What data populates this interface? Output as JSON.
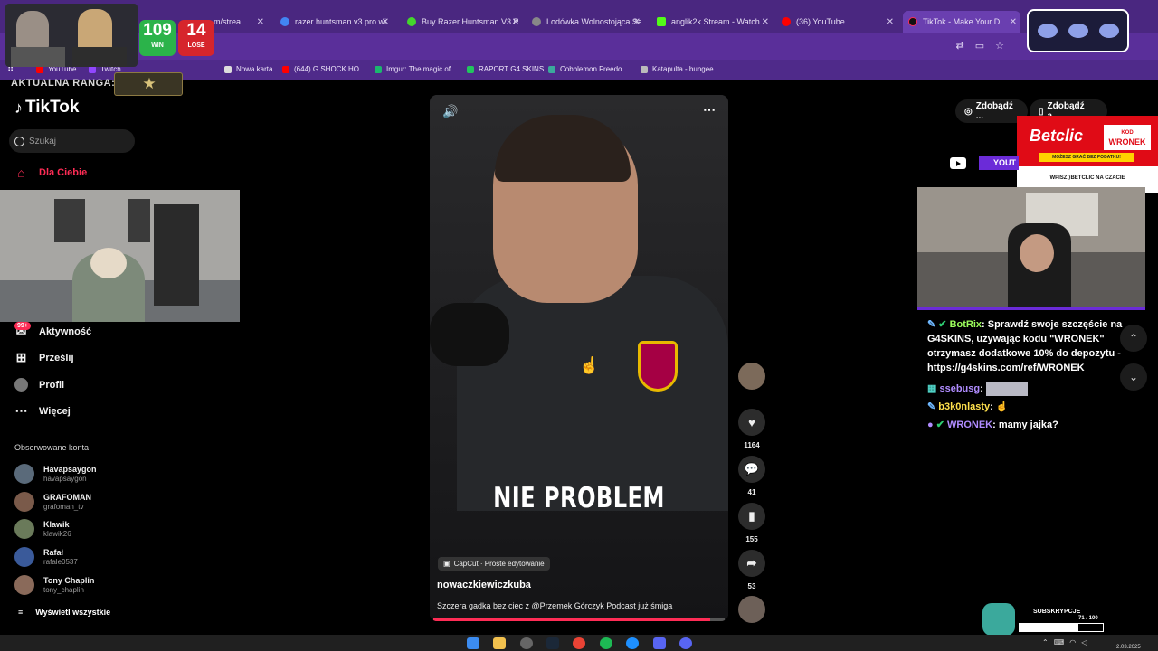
{
  "browser": {
    "tabs": [
      {
        "label": "m/strea",
        "color": "#8a8a8a"
      },
      {
        "label": "razer huntsman v3 pro wi",
        "color": "#4285f4"
      },
      {
        "label": "Buy Razer Huntsman V3 P",
        "color": "#44d62c"
      },
      {
        "label": "Lodówka Wolnostojąca Sa",
        "color": "#888888"
      },
      {
        "label": "anglik2k Stream - Watch",
        "color": "#53fc18"
      },
      {
        "label": "(36) YouTube",
        "color": "#ff0000"
      },
      {
        "label": "TikTok - Make Your D",
        "color": "#111111"
      }
    ],
    "bookmarks": [
      {
        "label": "YouTube",
        "color": "#ff0000"
      },
      {
        "label": "Twitch",
        "color": "#9146ff"
      },
      {
        "label": "Nowa karta",
        "color": "#dddddd"
      },
      {
        "label": "(644) G SHOCK HO...",
        "color": "#ff0000"
      },
      {
        "label": "Imgur: The magic of...",
        "color": "#1bb76e"
      },
      {
        "label": "RAPORT G4 SKINS",
        "color": "#22c55e"
      },
      {
        "label": "Cobblemon Freedo...",
        "color": "#3ba99c"
      },
      {
        "label": "Katapulta - bungee...",
        "color": "#bbbbbb"
      }
    ]
  },
  "overlay": {
    "wins": "109",
    "wins_label": "WIN",
    "losses": "14",
    "losses_label": "LOSE",
    "rank_label": "AKTUALNA RANGA:"
  },
  "tiktok": {
    "logo": "TikTok",
    "search_placeholder": "Szukaj",
    "nav": {
      "for_you": "Dla Ciebie",
      "activity": "Aktywność",
      "activity_badge": "99+",
      "upload": "Prześlij",
      "profile": "Profil",
      "more": "Więcej"
    },
    "followed_title": "Obserwowane konta",
    "followed": [
      {
        "name": "Havapsaygon",
        "handle": "havapsaygon",
        "color": "#5a6a7a"
      },
      {
        "name": "GRAFOMAN",
        "handle": "grafoman_tv",
        "color": "#7a5a4a"
      },
      {
        "name": "Klawik",
        "handle": "klawik26",
        "color": "#6a7a5a"
      },
      {
        "name": "Rafał",
        "handle": "rafale0537",
        "color": "#3a5a9a"
      },
      {
        "name": "Tony Chaplin",
        "handle": "tony_chaplin",
        "color": "#8a6a5a"
      }
    ],
    "show_all": "Wyświetl wszystkie",
    "video": {
      "caption_big": "NIE PROBLEM",
      "capcut": "CapCut · Proste edytowanie",
      "author": "nowaczkiewiczkuba",
      "description": "Szczera gadka bez ciec z @Przemek Górczyk Podcast już śmiga",
      "progress": 0.95
    },
    "actions": {
      "likes": "1164",
      "comments": "41",
      "saves": "155",
      "shares": "53"
    },
    "get_buttons": [
      "Zdobądź ...",
      "Zdobądź a..."
    ]
  },
  "sponsor": {
    "brand": "Betclic",
    "kod_label": "KOD",
    "code": "WRONEK",
    "strip": "MOŻESZ GRAĆ BEZ PODATKU!",
    "line": "WPISZ ⟩BETCLIC NA CZACIE"
  },
  "stream": {
    "yt_label": "YOUT",
    "chat": [
      {
        "user": "BotRix",
        "user_color": "#9dff5c",
        "text": ": Sprawdź swoje szczęście na G4SKINS, używając kodu \"WRONEK\" otrzymasz dodatkowe 10% do depozytu - https://g4skins.com/ref/WRONEK"
      },
      {
        "user": "ssebusg",
        "user_color": "#b08cff",
        "text": ":"
      },
      {
        "user": "b3k0nlasty",
        "user_color": "#ffe14d",
        "text": ":"
      },
      {
        "user": "WRONEK",
        "user_color": "#b08cff",
        "text": ": mamy jajka?"
      }
    ],
    "subs_label": "SUBSKRYPCJE",
    "subs_count": "71 / 100",
    "subs_fraction": 0.71
  },
  "taskbar": {
    "time": "2.03.2025"
  }
}
